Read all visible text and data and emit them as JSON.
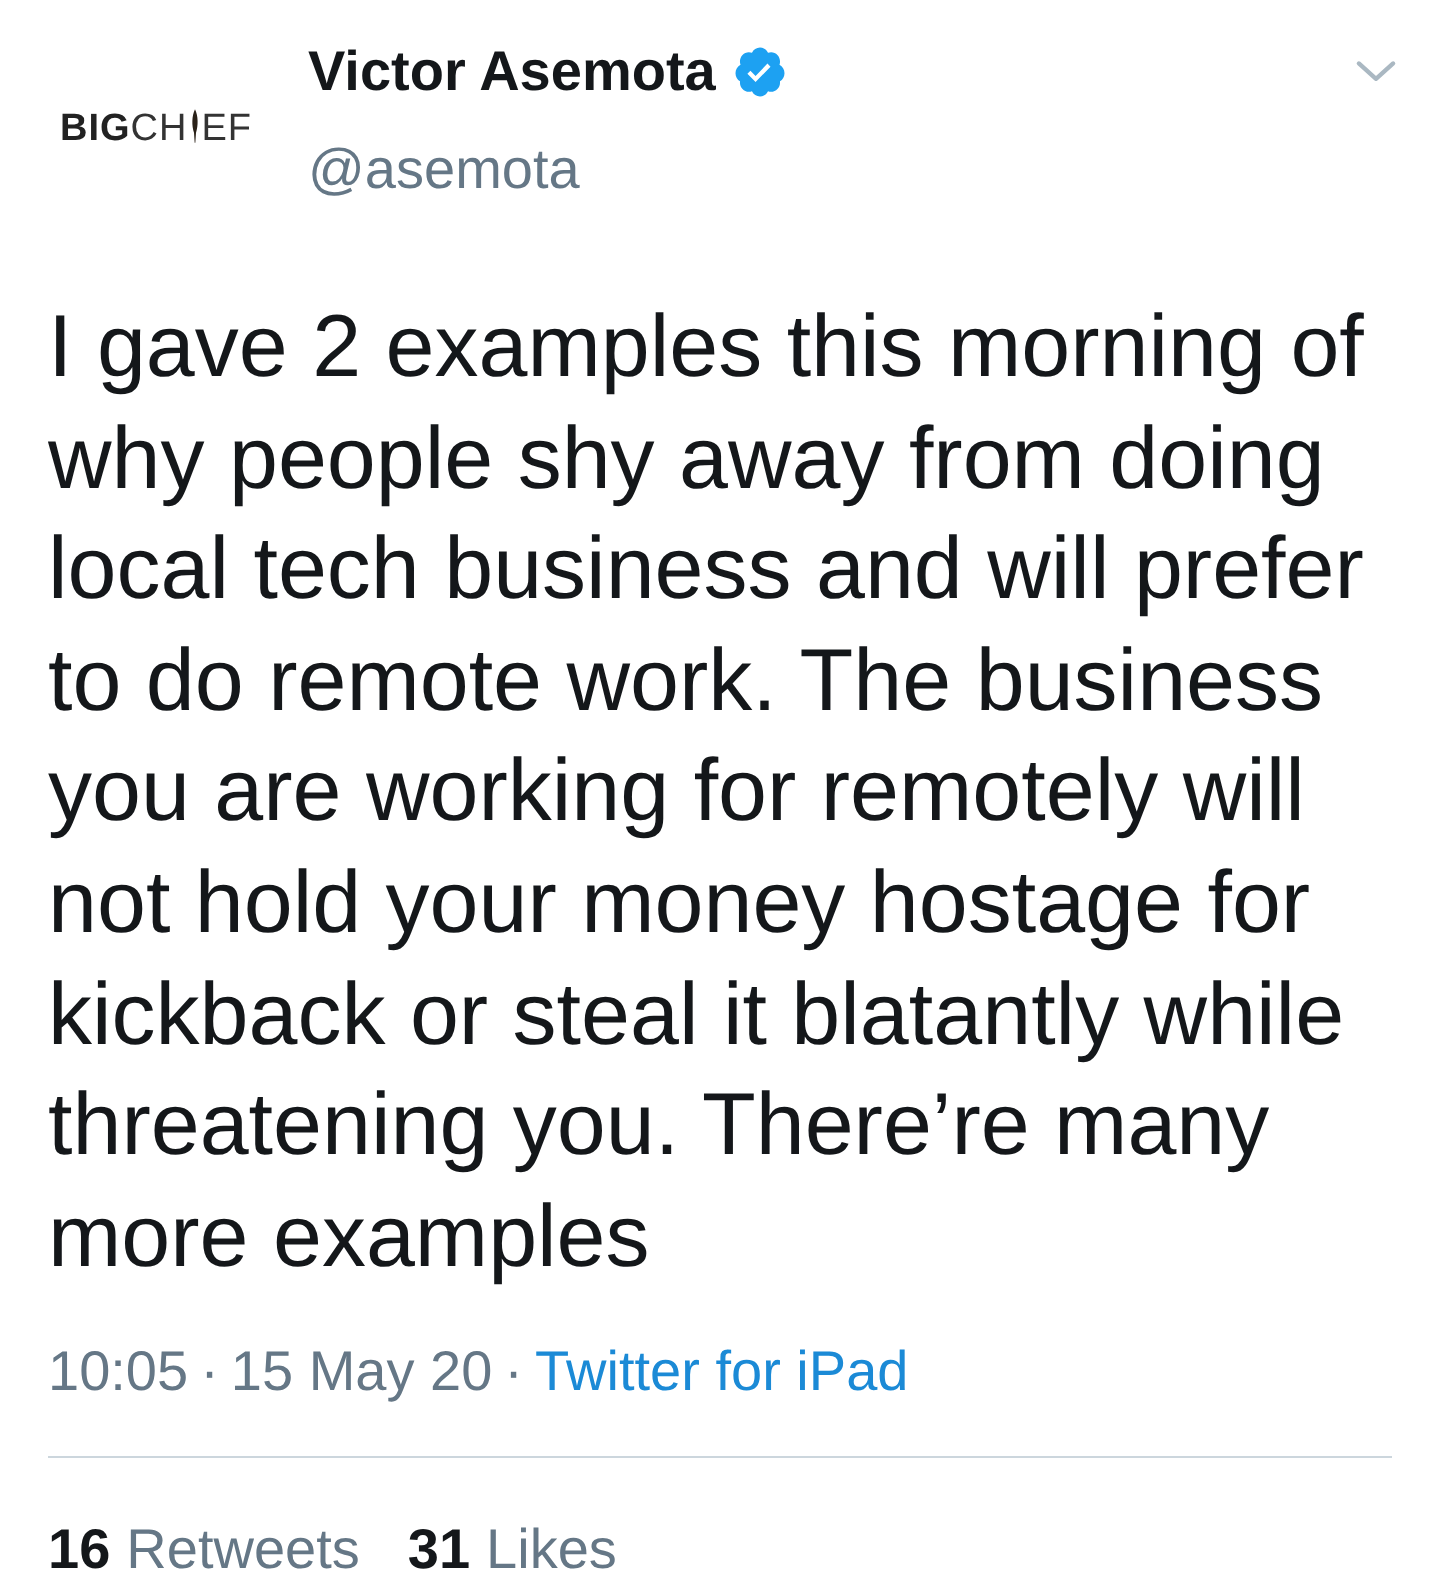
{
  "author": {
    "avatar_logo": {
      "bold_part": "BIG",
      "light_part_before": "CH",
      "light_part_after": "EF"
    },
    "name": "Victor Asemota",
    "verified": true,
    "handle": "@asemota"
  },
  "tweet": {
    "text": "I gave 2 examples this morning of why people shy away from doing local tech business and will prefer to do remote work. The business you are working for remotely will not hold your money hostage for kickback or steal it blatantly while threatening you. There’re many more examples"
  },
  "meta": {
    "time": "10:05",
    "separator_1": "·",
    "date": "15 May 20",
    "separator_2": "·",
    "source": "Twitter for iPad"
  },
  "stats": [
    {
      "count": "16",
      "label": "Retweets"
    },
    {
      "count": "31",
      "label": "Likes"
    }
  ]
}
